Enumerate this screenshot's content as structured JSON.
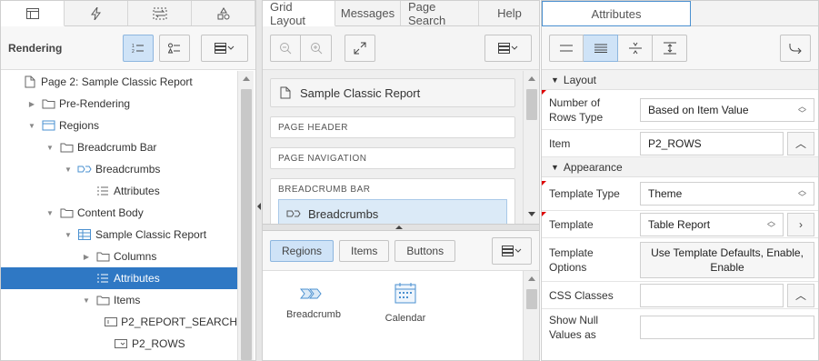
{
  "left": {
    "tabs": [
      "rendering-icon",
      "dynamic-actions-icon",
      "processing-icon",
      "shared-components-icon"
    ],
    "title": "Rendering",
    "tree": [
      {
        "label": "Page 2: Sample Classic Report",
        "indent": 0,
        "icon": "page-icon",
        "toggle": ""
      },
      {
        "label": "Pre-Rendering",
        "indent": 1,
        "icon": "folder-icon",
        "toggle": "▶"
      },
      {
        "label": "Regions",
        "indent": 1,
        "icon": "region-icon",
        "toggle": "▼"
      },
      {
        "label": "Breadcrumb Bar",
        "indent": 2,
        "icon": "folder-icon",
        "toggle": "▼"
      },
      {
        "label": "Breadcrumbs",
        "indent": 3,
        "icon": "breadcrumb-icon",
        "toggle": "▼"
      },
      {
        "label": "Attributes",
        "indent": 4,
        "icon": "list-icon",
        "toggle": ""
      },
      {
        "label": "Content Body",
        "indent": 2,
        "icon": "folder-icon",
        "toggle": "▼"
      },
      {
        "label": "Sample Classic Report",
        "indent": 3,
        "icon": "table-icon",
        "toggle": "▼"
      },
      {
        "label": "Columns",
        "indent": 4,
        "icon": "folder-icon",
        "toggle": "▶"
      },
      {
        "label": "Attributes",
        "indent": 4,
        "icon": "list-icon",
        "toggle": "",
        "selected": true
      },
      {
        "label": "Items",
        "indent": 4,
        "icon": "folder-icon",
        "toggle": "▼"
      },
      {
        "label": "P2_REPORT_SEARCH",
        "indent": 5,
        "icon": "text-item-icon",
        "toggle": ""
      },
      {
        "label": "P2_ROWS",
        "indent": 5,
        "icon": "select-item-icon",
        "toggle": ""
      }
    ]
  },
  "mid": {
    "tabs": [
      "Grid Layout",
      "Messages",
      "Page Search",
      "Help"
    ],
    "page_title": "Sample Classic Report",
    "sections": {
      "page_header": "PAGE HEADER",
      "page_navigation": "PAGE NAVIGATION",
      "breadcrumb_bar": "BREADCRUMB BAR"
    },
    "breadcrumb_region": "Breadcrumbs",
    "gallery_tabs": [
      "Regions",
      "Items",
      "Buttons"
    ],
    "gallery_items": [
      {
        "label": "Breadcrumb",
        "icon": "breadcrumb-icon"
      },
      {
        "label": "Calendar",
        "icon": "calendar-icon"
      }
    ]
  },
  "right": {
    "tab": "Attributes",
    "groups": {
      "layout": "Layout",
      "appearance": "Appearance"
    },
    "props": {
      "rows_type": {
        "label": "Number of Rows Type",
        "value": "Based on Item Value"
      },
      "item": {
        "label": "Item",
        "value": "P2_ROWS"
      },
      "template_type": {
        "label": "Template Type",
        "value": "Theme"
      },
      "template": {
        "label": "Template",
        "value": "Table Report"
      },
      "template_options": {
        "label": "Template Options",
        "value": "Use Template Defaults, Enable, Enable"
      },
      "css_classes": {
        "label": "CSS Classes",
        "value": ""
      },
      "show_null": {
        "label": "Show Null Values as",
        "value": ""
      }
    }
  }
}
